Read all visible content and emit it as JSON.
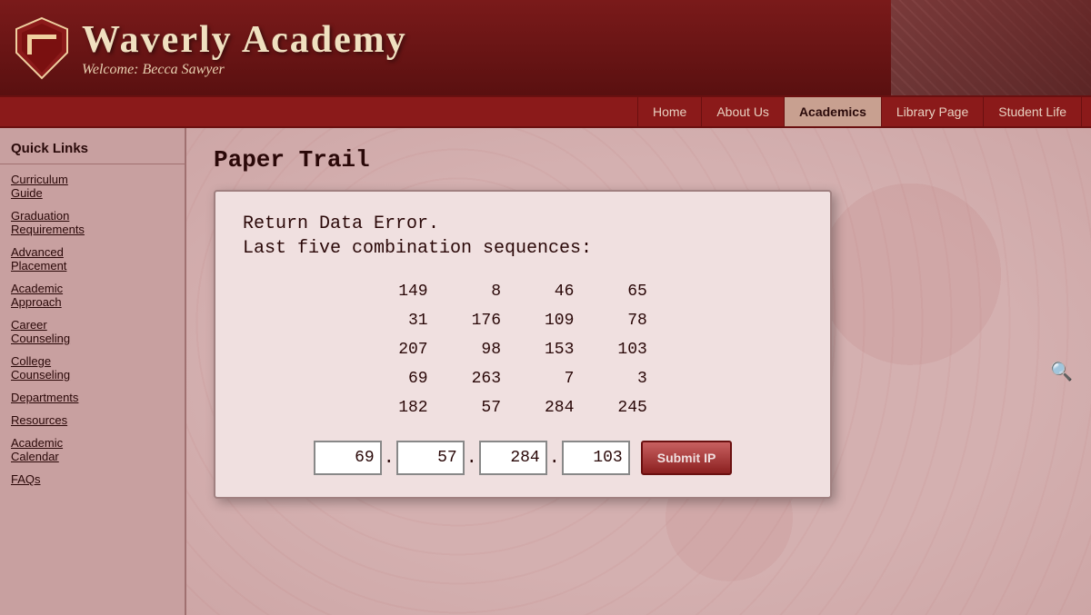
{
  "header": {
    "site_title": "Waverly Academy",
    "welcome_text": "Welcome: Becca Sawyer"
  },
  "nav": {
    "items": [
      {
        "label": "Home",
        "active": false
      },
      {
        "label": "About Us",
        "active": false
      },
      {
        "label": "Academics",
        "active": true
      },
      {
        "label": "Library Page",
        "active": false
      },
      {
        "label": "Student Life",
        "active": false
      }
    ]
  },
  "sidebar": {
    "header": "Quick Links",
    "items": [
      {
        "label": "Curriculum Guide"
      },
      {
        "label": "Graduation Requirements"
      },
      {
        "label": "Advanced Placement"
      },
      {
        "label": "Academic Approach"
      },
      {
        "label": "Career Counseling"
      },
      {
        "label": "College Counseling"
      },
      {
        "label": "Departments"
      },
      {
        "label": "Resources"
      },
      {
        "label": "Academic Calendar"
      },
      {
        "label": "FAQs"
      }
    ]
  },
  "content": {
    "page_title": "Paper Trail",
    "error_line1": "Return Data Error.",
    "error_line2": "Last five combination sequences:",
    "combinations": [
      [
        149,
        8,
        46,
        65
      ],
      [
        31,
        176,
        109,
        78
      ],
      [
        207,
        98,
        153,
        103
      ],
      [
        69,
        263,
        7,
        3
      ],
      [
        182,
        57,
        284,
        245
      ]
    ],
    "input": {
      "field1": "69",
      "field2": "57",
      "field3": "284",
      "field4": "103"
    },
    "submit_label": "Submit IP"
  }
}
